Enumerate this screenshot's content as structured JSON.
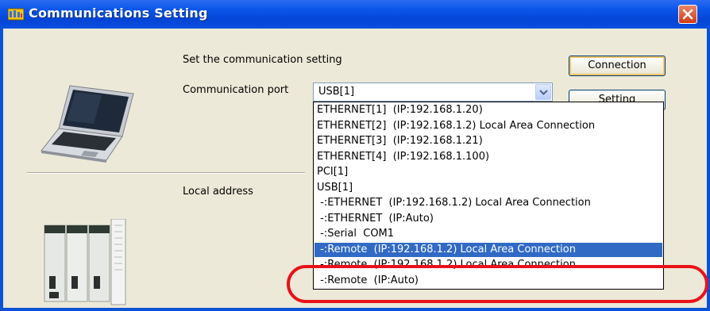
{
  "window": {
    "title": "Communications Setting"
  },
  "dialog": {
    "heading": "Set the communication setting",
    "port_label": "Communication port",
    "local_address_label": "Local address"
  },
  "combo": {
    "value": "USB[1]"
  },
  "buttons": {
    "connection": "Connection",
    "setting": "Setting"
  },
  "dropdown": {
    "items": [
      "ETHERNET[1]  (IP:192.168.1.20)",
      "ETHERNET[2]  (IP:192.168.1.2) Local Area Connection",
      "ETHERNET[3]  (IP:192.168.1.21)",
      "ETHERNET[4]  (IP:192.168.1.100)",
      "PCI[1]",
      "USB[1]",
      " -:ETHERNET  (IP:192.168.1.2) Local Area Connection",
      " -:ETHERNET  (IP:Auto)",
      " -:Serial  COM1",
      " -:Remote  (IP:192.168.1.2) Local Area Connection",
      " -:Remote  (IP:192.168.1.2) Local Area Connection",
      " -:Remote  (IP:Auto)"
    ],
    "selected_index": 9
  },
  "colors": {
    "titlebar": "#0a55e8",
    "selection": "#316ac5",
    "highlight_ring": "#e8121a",
    "dialog_bg": "#ece9d8"
  },
  "icons": [
    "app-icon",
    "close-icon",
    "dropdown-arrow-icon",
    "laptop-icon",
    "plc-server-icon"
  ]
}
